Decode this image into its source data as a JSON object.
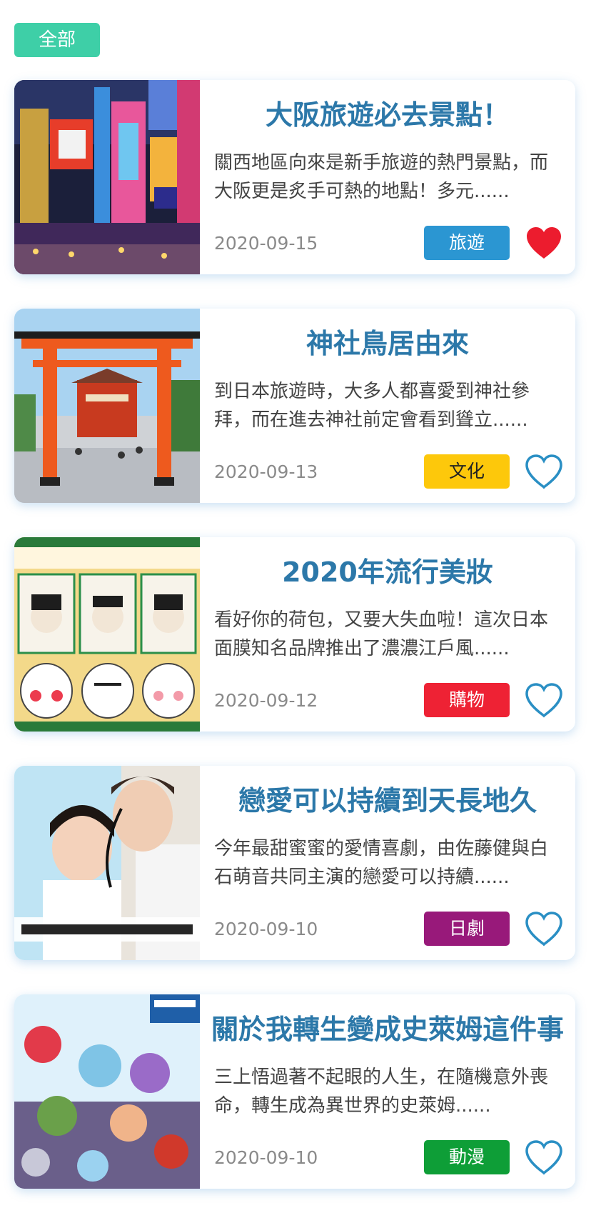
{
  "filter": {
    "label": "全部",
    "color": "#3ecfa7"
  },
  "colors": {
    "title": "#2c78a9",
    "heart_active": "#ec1c2e",
    "heart_outline": "#2a8fc4"
  },
  "articles": [
    {
      "title": "大阪旅遊必去景點！",
      "excerpt": "關西地區向來是新手旅遊的熱門景點，而大阪更是炙手可熱的地點！多元......",
      "date": "2020-09-15",
      "tag": "旅遊",
      "tag_bg": "#2b96d2",
      "tag_fg": "#ffffff",
      "favorited": true,
      "image": "osaka-neon-street-photo"
    },
    {
      "title": "神社鳥居由來",
      "excerpt": "到日本旅遊時，大多人都喜愛到神社參拜，而在進去神社前定會看到聳立......",
      "date": "2020-09-13",
      "tag": "文化",
      "tag_bg": "#fdc80b",
      "tag_fg": "#222222",
      "favorited": false,
      "image": "torii-gate-shrine-photo"
    },
    {
      "title": "2020年流行美妝",
      "excerpt": "看好你的荷包，又要大失血啦！這次日本面膜知名品牌推出了濃濃江戶風......",
      "date": "2020-09-12",
      "tag": "購物",
      "tag_bg": "#ee2234",
      "tag_fg": "#ffffff",
      "favorited": false,
      "image": "edo-face-mask-product-photo"
    },
    {
      "title": "戀愛可以持續到天長地久",
      "excerpt": "今年最甜蜜蜜的愛情喜劇，由佐藤健與白石萌音共同主演的戀愛可以持續......",
      "date": "2020-09-10",
      "tag": "日劇",
      "tag_bg": "#98197a",
      "tag_fg": "#ffffff",
      "favorited": false,
      "image": "drama-poster-photo"
    },
    {
      "title": "關於我轉生變成史萊姆這件事",
      "excerpt": "三上悟過著不起眼的人生，在隨機意外喪命，轉生成為異世界的史萊姆......",
      "date": "2020-09-10",
      "tag": "動漫",
      "tag_bg": "#0e9e37",
      "tag_fg": "#ffffff",
      "favorited": false,
      "image": "anime-key-visual-illustration"
    }
  ]
}
